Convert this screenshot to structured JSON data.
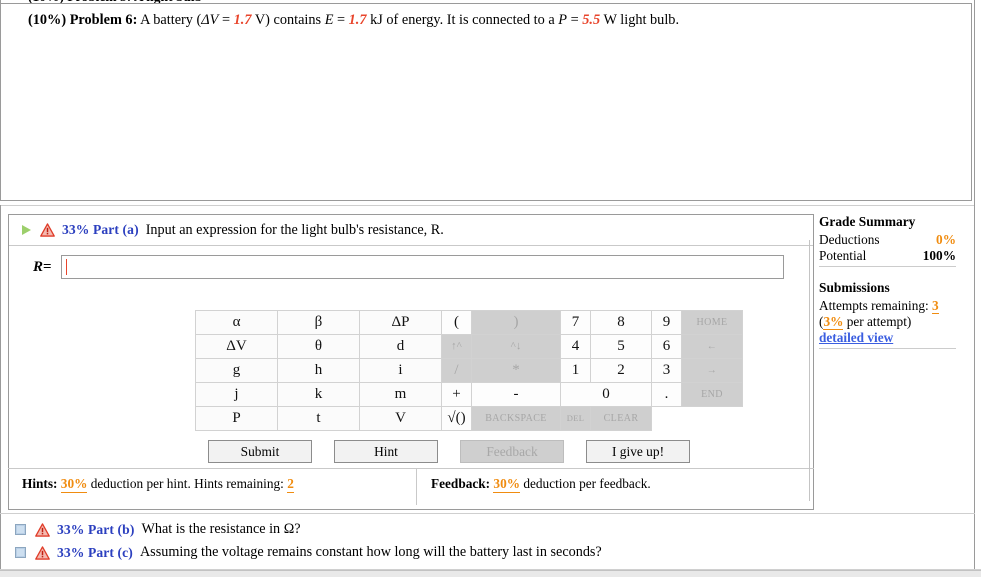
{
  "problem": {
    "percent": "(10%)",
    "label": "Problem 6:",
    "seg1": "A battery (",
    "dv_sym": "ΔV",
    "eq1": " = ",
    "dv_val": "1.7",
    "seg2": " V) contains ",
    "e_sym": "E",
    "eq2": " = ",
    "e_val": "1.7",
    "seg3": " kJ of energy. It is connected to a ",
    "p_sym": "P",
    "eq3": " = ",
    "p_val": "5.5",
    "seg4": " W light bulb."
  },
  "part_a": {
    "percent_label": "33% Part (a)",
    "prompt": "Input an expression for the light bulb's resistance, R.",
    "answer_label_var": "R",
    "answer_label_eq": "=",
    "answer_value": "",
    "answer_placeholder": ""
  },
  "keypad": {
    "rows": [
      [
        {
          "label": "α",
          "kind": "alpha",
          "enabled": true
        },
        {
          "label": "β",
          "kind": "alpha",
          "enabled": true
        },
        {
          "label": "ΔP",
          "kind": "alpha",
          "enabled": true
        },
        {
          "label": "(",
          "kind": "op",
          "enabled": true
        },
        {
          "label": ")",
          "kind": "op",
          "enabled": false
        },
        {
          "label": "7",
          "kind": "num",
          "enabled": true
        },
        {
          "label": "8",
          "kind": "num",
          "enabled": true
        },
        {
          "label": "9",
          "kind": "num",
          "enabled": true
        },
        {
          "label": "HOME",
          "kind": "func",
          "enabled": false
        }
      ],
      [
        {
          "label": "ΔV",
          "kind": "alpha",
          "enabled": true
        },
        {
          "label": "θ",
          "kind": "alpha",
          "enabled": true
        },
        {
          "label": "d",
          "kind": "alpha",
          "enabled": true
        },
        {
          "label": "↑^",
          "kind": "arrw",
          "enabled": false
        },
        {
          "label": "^↓",
          "kind": "arrw",
          "enabled": false
        },
        {
          "label": "4",
          "kind": "num",
          "enabled": true
        },
        {
          "label": "5",
          "kind": "num",
          "enabled": true
        },
        {
          "label": "6",
          "kind": "num",
          "enabled": true
        },
        {
          "label": "←",
          "kind": "func",
          "enabled": false
        }
      ],
      [
        {
          "label": "g",
          "kind": "alpha",
          "enabled": true
        },
        {
          "label": "h",
          "kind": "alpha",
          "enabled": true
        },
        {
          "label": "i",
          "kind": "alpha",
          "enabled": true
        },
        {
          "label": "/",
          "kind": "op",
          "enabled": false
        },
        {
          "label": "*",
          "kind": "op",
          "enabled": false
        },
        {
          "label": "1",
          "kind": "num",
          "enabled": true
        },
        {
          "label": "2",
          "kind": "num",
          "enabled": true
        },
        {
          "label": "3",
          "kind": "num",
          "enabled": true
        },
        {
          "label": "→",
          "kind": "func",
          "enabled": false
        }
      ],
      [
        {
          "label": "j",
          "kind": "alpha",
          "enabled": true
        },
        {
          "label": "k",
          "kind": "alpha",
          "enabled": true
        },
        {
          "label": "m",
          "kind": "alpha",
          "enabled": true
        },
        {
          "label": "+",
          "kind": "op",
          "enabled": true
        },
        {
          "label": "-",
          "kind": "op",
          "enabled": true
        },
        {
          "label": "0",
          "kind": "num2",
          "enabled": true
        },
        {
          "label": ".",
          "kind": "op",
          "enabled": true
        },
        {
          "label": "END",
          "kind": "func",
          "enabled": false
        }
      ],
      [
        {
          "label": "P",
          "kind": "alpha",
          "enabled": true
        },
        {
          "label": "t",
          "kind": "alpha",
          "enabled": true
        },
        {
          "label": "V",
          "kind": "alpha",
          "enabled": true
        },
        {
          "label": "√()",
          "kind": "op",
          "enabled": true
        },
        {
          "label": "BACKSPACE",
          "kind": "wide",
          "enabled": false
        },
        {
          "label": "DEL",
          "kind": "tiny",
          "enabled": false
        },
        {
          "label": "CLEAR",
          "kind": "func",
          "enabled": false
        }
      ]
    ]
  },
  "buttons": {
    "submit": "Submit",
    "hint": "Hint",
    "feedback": "Feedback",
    "give_up": "I give up!"
  },
  "hints": {
    "label": "Hints:",
    "percent": "30%",
    "text": "deduction per hint. Hints remaining:",
    "remaining": "2"
  },
  "feedback": {
    "label": "Feedback:",
    "percent": "30%",
    "text": "deduction per feedback."
  },
  "sidebar": {
    "grade_title": "Grade Summary",
    "deductions_label": "Deductions",
    "deductions_value": "0%",
    "potential_label": "Potential",
    "potential_value": "100%",
    "submissions_title": "Submissions",
    "attempts_label": "Attempts remaining:",
    "attempts_value": "3",
    "per_attempt_open": "(",
    "per_attempt_pct": "3%",
    "per_attempt_text": " per attempt)",
    "detailed_view": "detailed view"
  },
  "parts_bc": [
    {
      "percent_label": "33% Part (b)",
      "prompt": "What is the resistance in Ω?"
    },
    {
      "percent_label": "33% Part (c)",
      "prompt": "Assuming the voltage remains constant how long will the battery last in seconds?"
    }
  ],
  "colors": {
    "accent_blue": "#2b3fbf",
    "value_red": "#e8452c",
    "orange": "#f08c10",
    "link_blue": "#3b5ee0",
    "green_triangle": "#9ccf6b",
    "warn_red": "#e03b28"
  }
}
